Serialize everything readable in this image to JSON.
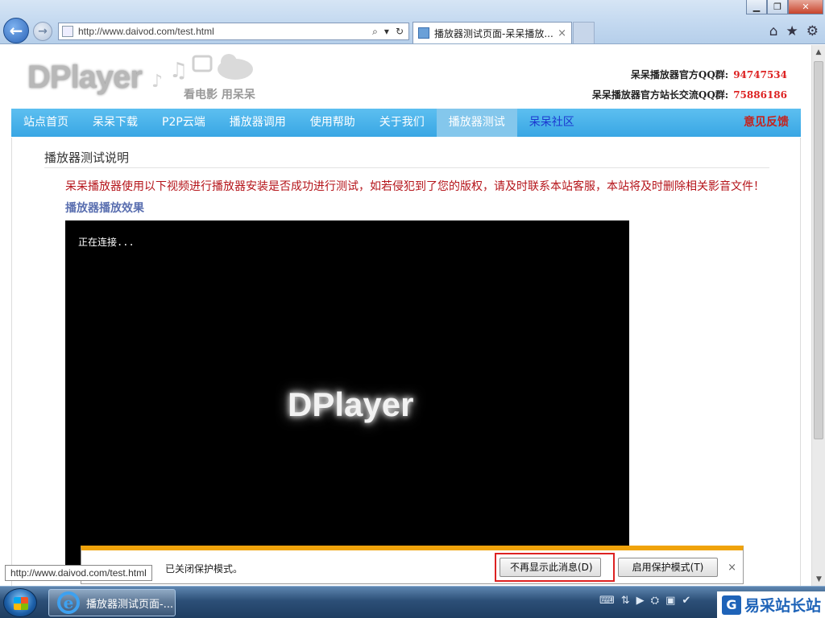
{
  "browser": {
    "url": "http://www.daivod.com/test.html",
    "tab_title": "播放器测试页面-呆呆播放...",
    "tab_close": "×",
    "back_glyph": "←",
    "fwd_glyph": "→",
    "win_min": "▁",
    "win_max": "❐",
    "win_close": "✕",
    "search_glyph": "⌕",
    "dropdown_glyph": "▾",
    "refresh_glyph": "↻",
    "home_glyph": "⌂",
    "favorites_glyph": "★",
    "settings_glyph": "⚙"
  },
  "site": {
    "logo": "DPlayer",
    "slogan": "看电影 用呆呆",
    "qq_group_label": "呆呆播放器官方QQ群:",
    "qq_group_number": "94747534",
    "qq_webmaster_label": "呆呆播放器官方站长交流QQ群:",
    "qq_webmaster_number": "75886186"
  },
  "nav": {
    "items": [
      {
        "label": "站点首页",
        "name": "nav-home",
        "active": false
      },
      {
        "label": "呆呆下载",
        "name": "nav-download",
        "active": false
      },
      {
        "label": "P2P云端",
        "name": "nav-p2p-cloud",
        "active": false
      },
      {
        "label": "播放器调用",
        "name": "nav-player-embed",
        "active": false
      },
      {
        "label": "使用帮助",
        "name": "nav-help",
        "active": false
      },
      {
        "label": "关于我们",
        "name": "nav-about",
        "active": false
      },
      {
        "label": "播放器测试",
        "name": "nav-player-test",
        "active": true
      }
    ],
    "community": "呆呆社区",
    "feedback": "意见反馈"
  },
  "content": {
    "section_title": "播放器测试说明",
    "notice": "呆呆播放器使用以下视频进行播放器安装是否成功进行测试，如若侵犯到了您的版权，请及时联系本站客服，本站将及时删除相关影音文件！",
    "sub_title": "播放器播放效果"
  },
  "player": {
    "status": "正在连接...",
    "watermark": "DPlayer"
  },
  "infobar": {
    "message": "已关闭保护模式。",
    "btn_dont_show": "不再显示此消息(D)",
    "btn_enable": "启用保护模式(T)",
    "close_glyph": "×"
  },
  "status_tip": "http://www.daivod.com/test.html",
  "taskbar": {
    "task_label": "播放器测试页面-...",
    "ie_glyph": "e",
    "tray_icons": [
      "⌨",
      "⇅",
      "▶",
      "⛭",
      "▣",
      "✔"
    ]
  },
  "corner_logo": {
    "mark": "G",
    "name": "易采站长站"
  },
  "colors": {
    "nav_bg": "#38a6e4",
    "nav_active": "#84c7ec",
    "notice_red": "#b5141a",
    "qq_number_red": "#dd2222",
    "infobar_accent": "#f0a30a"
  }
}
